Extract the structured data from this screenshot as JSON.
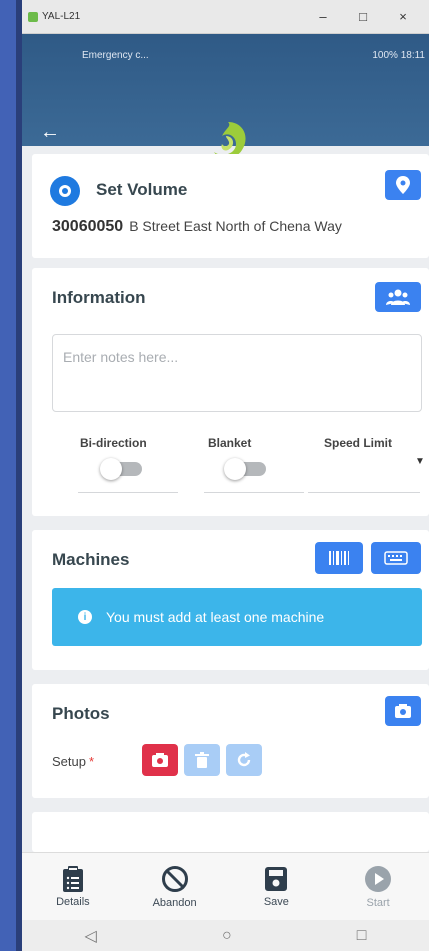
{
  "window": {
    "title": "YAL-L21",
    "minimize": "–",
    "maximize": "□",
    "close": "×"
  },
  "status_bar": {
    "left": "Emergency c...",
    "right": "100% 18:11"
  },
  "header": {
    "back_icon": "arrow-left-icon",
    "logo": "swirl-logo"
  },
  "set_volume": {
    "title": "Set Volume",
    "site_id": "30060050",
    "address": "B Street East North of Chena Way"
  },
  "information": {
    "title": "Information",
    "notes_placeholder": "Enter notes here...",
    "bi_direction_label": "Bi-direction",
    "blanket_label": "Blanket",
    "speed_limit_label": "Speed Limit"
  },
  "machines": {
    "title": "Machines",
    "banner": "You must add at least one machine"
  },
  "photos": {
    "title": "Photos",
    "setup_label": "Setup",
    "required_mark": "*"
  },
  "bottom_nav": {
    "details": "Details",
    "abandon": "Abandon",
    "save": "Save",
    "start": "Start"
  },
  "colors": {
    "primary": "#3b82f0",
    "header": "#2f5a86",
    "banner": "#3cb5ea",
    "danger": "#e0314a"
  }
}
